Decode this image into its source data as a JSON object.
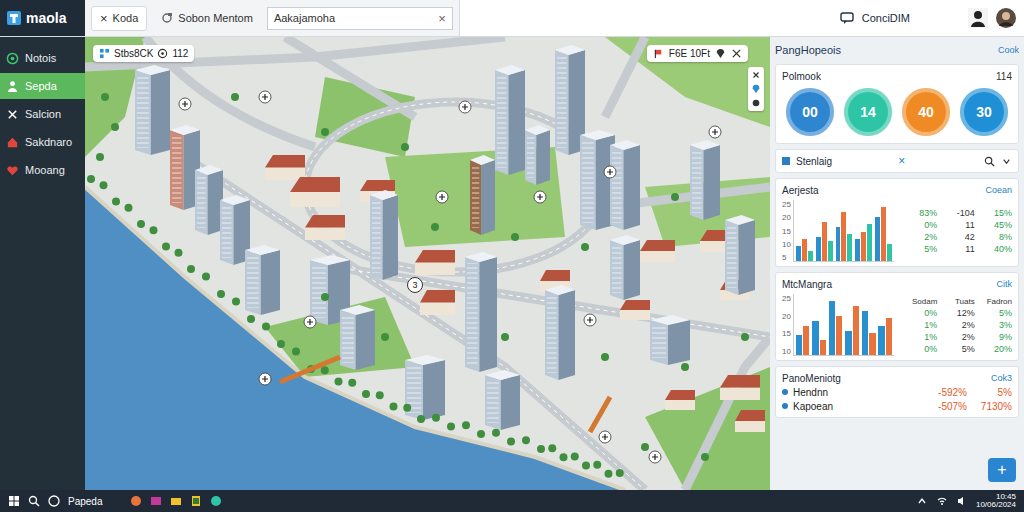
{
  "app": {
    "logo": "maola"
  },
  "tabs": [
    {
      "label": "Koda",
      "close": "×",
      "selected": true
    },
    {
      "label": "Sobon Mentom",
      "selected": false
    }
  ],
  "search": {
    "value": "Aakajamoha",
    "clear": "×"
  },
  "user": {
    "name": "ConciDIM"
  },
  "sidebar": {
    "items": [
      {
        "label": "Notois",
        "selected": false
      },
      {
        "label": "Sepda",
        "selected": true
      },
      {
        "label": "Salcion",
        "selected": false
      },
      {
        "label": "Sakdnaro",
        "selected": false
      },
      {
        "label": "Mooang",
        "selected": false
      }
    ]
  },
  "map": {
    "chip": {
      "label": "Stbs8CK",
      "count": "112"
    },
    "tools": {
      "label": "F6E 10Ft"
    },
    "badge": "3"
  },
  "panel": {
    "title": "PangHopeois",
    "action": "Cook"
  },
  "stats": {
    "title": "Polmook",
    "count": "114",
    "rings": [
      {
        "value": "00",
        "color": "#2f86d0"
      },
      {
        "value": "14",
        "color": "#2ec4a6"
      },
      {
        "value": "40",
        "color": "#f08a24"
      },
      {
        "value": "30",
        "color": "#1f8fd6"
      }
    ]
  },
  "filter": {
    "title": "Stenlaig",
    "close": "×"
  },
  "charts": [
    {
      "title": "Aerjesta",
      "action": "Coean",
      "ticks": [
        "25",
        "20",
        "15",
        "10",
        "5"
      ],
      "series": [
        {
          "color": "#2a8fcf",
          "values": [
            6,
            10,
            14,
            9,
            18
          ]
        },
        {
          "color": "#e8743b",
          "values": [
            9,
            16,
            20,
            12,
            22
          ]
        },
        {
          "color": "#2ec4a6",
          "values": [
            4,
            8,
            11,
            15,
            7
          ]
        }
      ],
      "columns": [],
      "rows": [
        [
          "83%",
          "-104",
          "15%"
        ],
        [
          "0%",
          "11",
          "45%"
        ],
        [
          "2%",
          "42",
          "8%"
        ],
        [
          "5%",
          "11",
          "40%"
        ]
      ]
    },
    {
      "title": "MtcMangra",
      "action": "Citk",
      "ticks": [
        "25",
        "20",
        "15",
        "10"
      ],
      "series": [
        {
          "color": "#2a8fcf",
          "values": [
            8,
            14,
            22,
            10,
            18,
            12
          ]
        },
        {
          "color": "#e8743b",
          "values": [
            12,
            6,
            16,
            20,
            9,
            15
          ]
        }
      ],
      "columns": [
        "Sodam",
        "Tuats",
        "Fadron"
      ],
      "rows": [
        [
          "0%",
          "12%",
          "5%"
        ],
        [
          "1%",
          "2%",
          "3%"
        ],
        [
          "1%",
          "2%",
          "9%"
        ],
        [
          "0%",
          "5%",
          "20%"
        ]
      ]
    }
  ],
  "list": {
    "title": "PanoMeniotg",
    "action": "Cok3",
    "rows": [
      {
        "name": "Hendnn",
        "change": "-592%",
        "value": "5%"
      },
      {
        "name": "Kapoean",
        "change": "-507%",
        "value": "7130%"
      }
    ]
  },
  "fab": "+",
  "taskbar": {
    "search": "Papeda",
    "time": "10:45",
    "date": "10/06/2024"
  }
}
